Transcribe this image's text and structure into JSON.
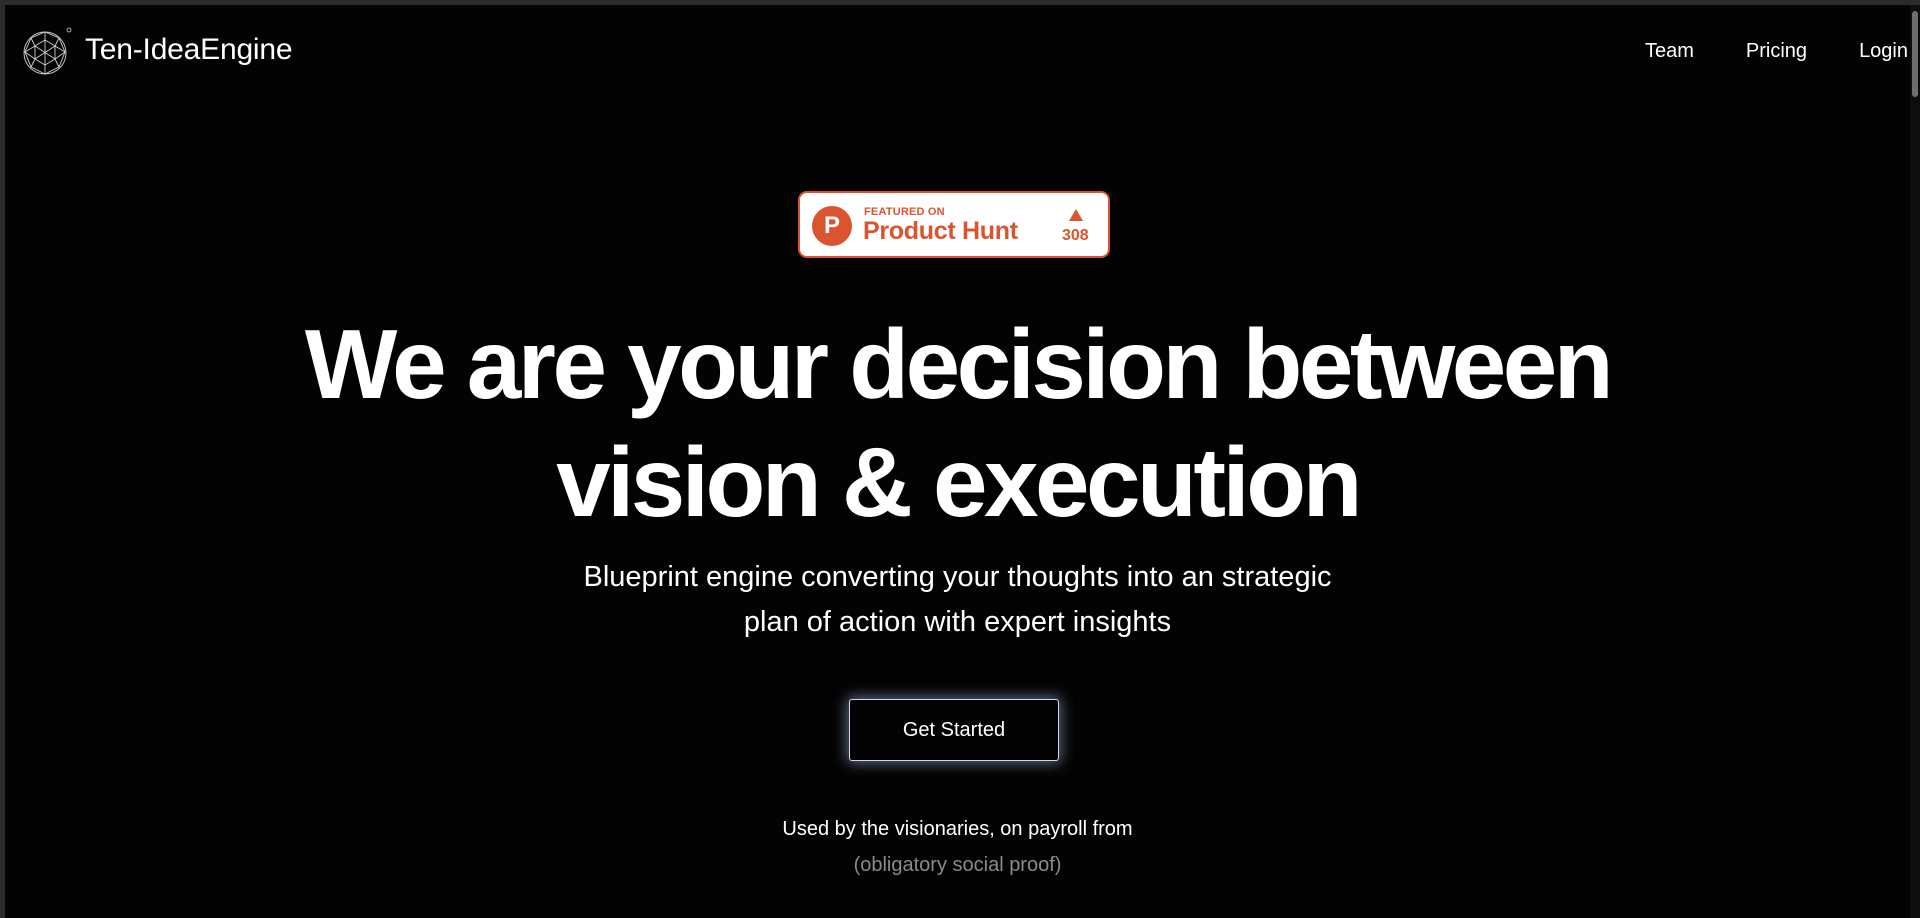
{
  "header": {
    "brand": "Ten-IdeaEngine",
    "logo_icon": "geodesic-sphere-icon",
    "nav": [
      {
        "label": "Team"
      },
      {
        "label": "Pricing"
      },
      {
        "label": "Login"
      }
    ]
  },
  "badge": {
    "featured_text": "FEATURED ON",
    "name": "Product Hunt",
    "letter": "P",
    "upvotes": "308",
    "color": "#da552f"
  },
  "hero": {
    "title_line1": "We are your decision between",
    "title_line2": "vision & execution",
    "subtitle_line1": "Blueprint engine converting your thoughts into an strategic",
    "subtitle_line2": "plan of action with expert insights",
    "cta_label": "Get Started"
  },
  "social_proof": {
    "text": "Used by the visionaries, on payroll from",
    "note": "(obligatory social proof)"
  },
  "colors": {
    "background": "#030303",
    "text": "#ffffff",
    "muted": "#8a8a8a"
  }
}
